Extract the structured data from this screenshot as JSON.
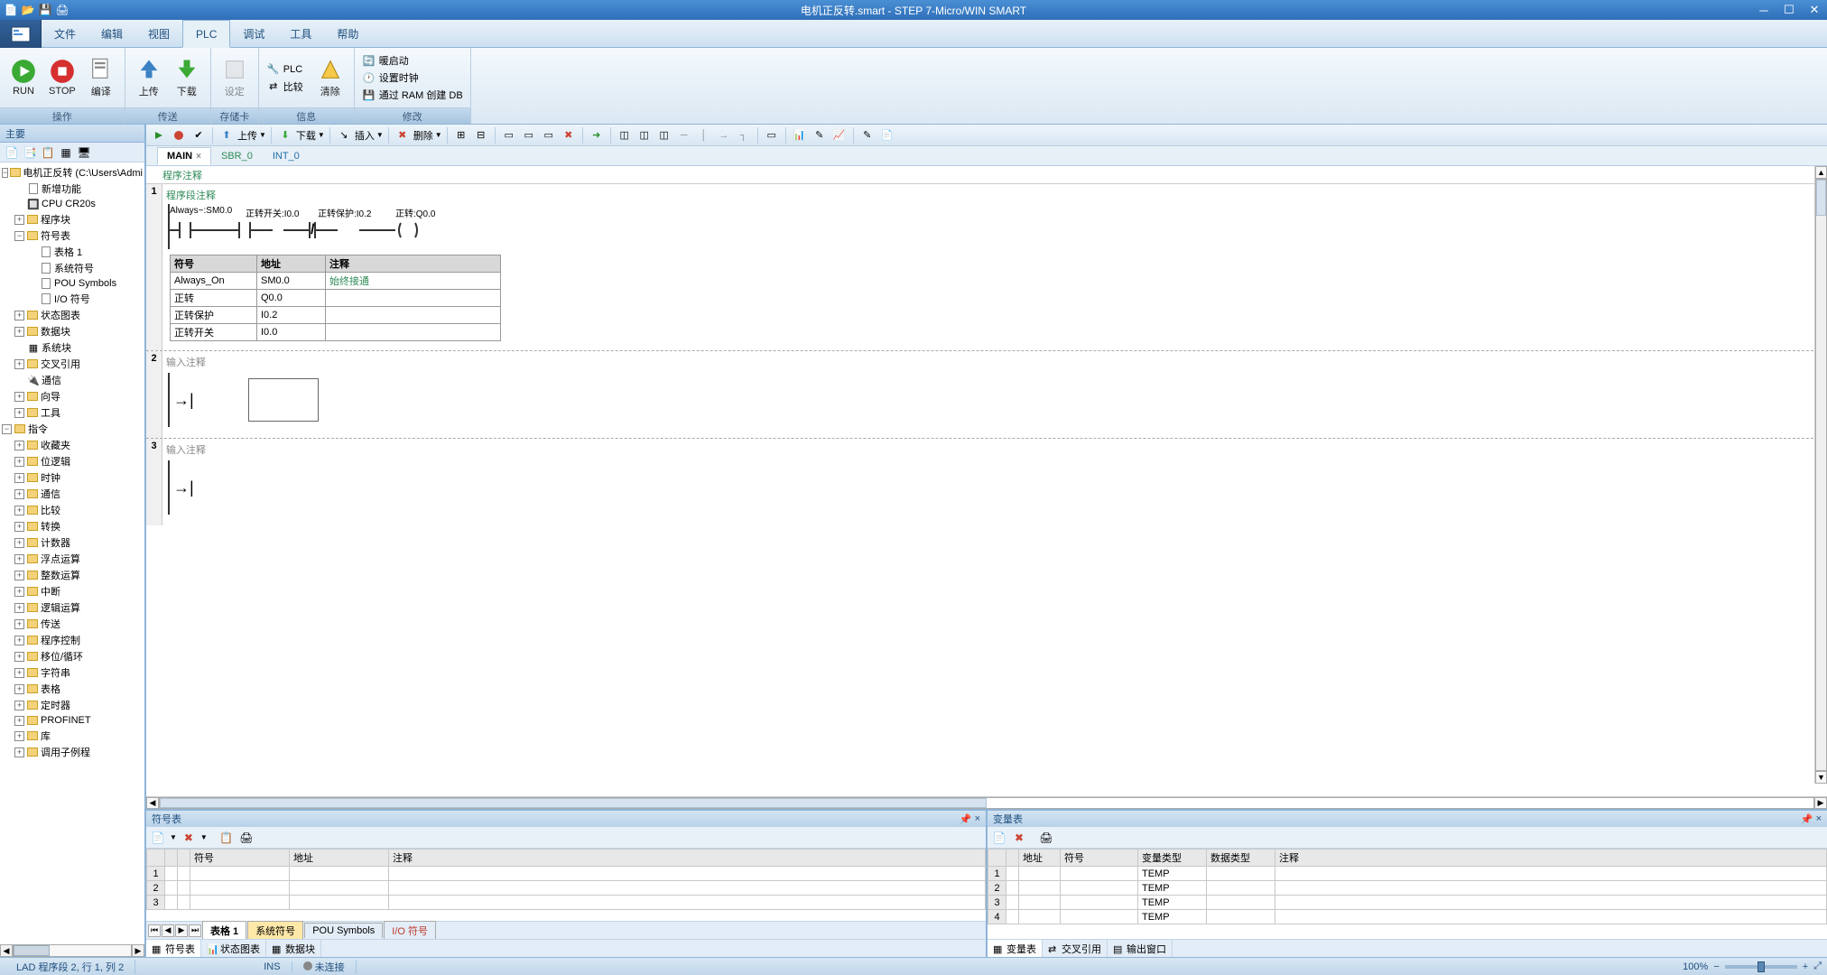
{
  "titlebar": {
    "title": "电机正反转.smart - STEP 7-Micro/WIN SMART"
  },
  "ribbon": {
    "tabs": [
      "文件",
      "编辑",
      "视图",
      "PLC",
      "调试",
      "工具",
      "帮助"
    ],
    "activeTab": "PLC",
    "groups": {
      "operate": {
        "name": "操作",
        "run": "RUN",
        "stop": "STOP",
        "compile": "编译"
      },
      "transfer": {
        "name": "传送",
        "upload": "上传",
        "download": "下载"
      },
      "memcard": {
        "name": "存储卡",
        "setup": "设定"
      },
      "info": {
        "name": "信息",
        "clear": "清除"
      },
      "modify": {
        "name": "修改",
        "plc": "PLC",
        "compare": "比较",
        "warmstart": "暖启动",
        "setclock": "设置时钟",
        "ramdb": "通过 RAM 创建 DB"
      }
    }
  },
  "leftPanel": {
    "title": "主要",
    "tree": {
      "project": "电机正反转 (C:\\Users\\Admi",
      "newFeatures": "新增功能",
      "cpu": "CPU CR20s",
      "programBlock": "程序块",
      "symbolTable": "符号表",
      "table1": "表格 1",
      "systemSymbols": "系统符号",
      "pouSymbols": "POU Symbols",
      "ioSymbols": "I/O 符号",
      "statusChart": "状态图表",
      "dataBlock": "数据块",
      "systemBlock": "系统块",
      "crossRef": "交叉引用",
      "comm": "通信",
      "wizards": "向导",
      "tools": "工具",
      "instructions": "指令",
      "favorites": "收藏夹",
      "bitLogic": "位逻辑",
      "clock": "时钟",
      "comm2": "通信",
      "compare": "比较",
      "convert": "转换",
      "counters": "计数器",
      "floatMath": "浮点运算",
      "intMath": "整数运算",
      "interrupt": "中断",
      "logicOps": "逻辑运算",
      "move": "传送",
      "progControl": "程序控制",
      "shiftRotate": "移位/循环",
      "string": "字符串",
      "table": "表格",
      "timers": "定时器",
      "profinet": "PROFINET",
      "library": "库",
      "callSub": "调用子例程"
    }
  },
  "toolstrip": {
    "upload": "上传",
    "download": "下载",
    "insert": "插入",
    "delete": "删除"
  },
  "editorTabs": {
    "main": "MAIN",
    "sbr": "SBR_0",
    "int": "INT_0"
  },
  "editor": {
    "programComment": "程序注释",
    "networkComment": "程序段注释",
    "inputComment": "输入注释",
    "labels": {
      "alwaysOn": "Always~:SM0.0",
      "fwdSwitch": "正转开关:I0.0",
      "fwdProtect": "正转保护:I0.2",
      "fwdOut": "正转:Q0.0"
    },
    "symTable": {
      "headers": {
        "symbol": "符号",
        "address": "地址",
        "comment": "注释"
      },
      "rows": [
        {
          "symbol": "Always_On",
          "address": "SM0.0",
          "comment": "始终接通"
        },
        {
          "symbol": "正转",
          "address": "Q0.0",
          "comment": ""
        },
        {
          "symbol": "正转保护",
          "address": "I0.2",
          "comment": ""
        },
        {
          "symbol": "正转开关",
          "address": "I0.0",
          "comment": ""
        }
      ]
    }
  },
  "symbolTablePanel": {
    "title": "符号表",
    "headers": {
      "symbol": "符号",
      "address": "地址",
      "comment": "注释"
    },
    "sheetTabs": {
      "table1": "表格 1",
      "sysSym": "系统符号",
      "pouSym": "POU Symbols",
      "ioSym": "I/O 符号"
    },
    "bottomTabs": {
      "symTable": "符号表",
      "statusChart": "状态图表",
      "dataBlock": "数据块"
    }
  },
  "varTablePanel": {
    "title": "变量表",
    "headers": {
      "address": "地址",
      "symbol": "符号",
      "varType": "变量类型",
      "dataType": "数据类型",
      "comment": "注释"
    },
    "rows": [
      {
        "varType": "TEMP"
      },
      {
        "varType": "TEMP"
      },
      {
        "varType": "TEMP"
      },
      {
        "varType": "TEMP"
      }
    ],
    "bottomTabs": {
      "varTable": "变量表",
      "crossRef": "交叉引用",
      "output": "输出窗口"
    }
  },
  "statusbar": {
    "left": "LAD 程序段 2, 行 1, 列 2",
    "ins": "INS",
    "conn": "未连接",
    "zoom": "100%"
  }
}
